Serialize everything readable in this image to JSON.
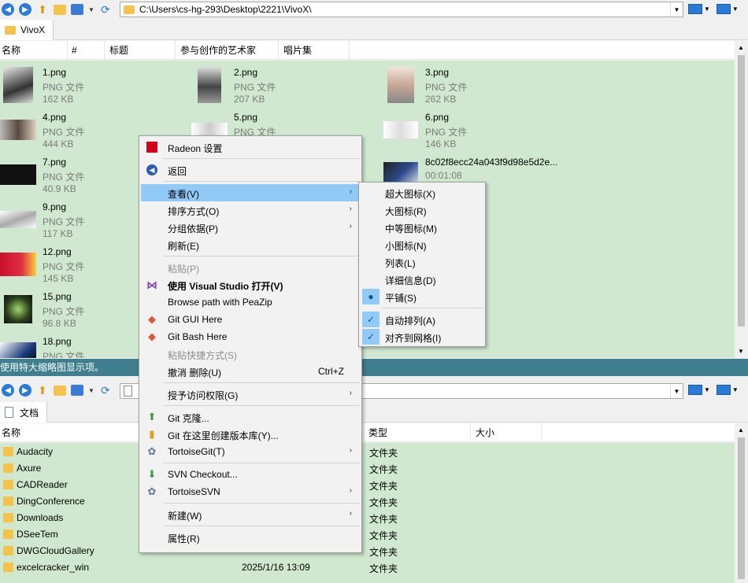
{
  "top_pane": {
    "address": "C:\\Users\\cs-hg-293\\Desktop\\2221\\VivoX\\",
    "tab_label": "VivoX",
    "columns": [
      "名称",
      "#",
      "标题",
      "参与创作的艺术家",
      "唱片集"
    ],
    "files": [
      {
        "name": "1.png",
        "type": "PNG 文件",
        "size": "162 KB"
      },
      {
        "name": "2.png",
        "type": "PNG 文件",
        "size": "207 KB"
      },
      {
        "name": "3.png",
        "type": "PNG 文件",
        "size": "262 KB"
      },
      {
        "name": "4.png",
        "type": "PNG 文件",
        "size": "444 KB"
      },
      {
        "name": "5.png",
        "type": "PNG 文件",
        "size": ""
      },
      {
        "name": "6.png",
        "type": "PNG 文件",
        "size": "146 KB"
      },
      {
        "name": "7.png",
        "type": "PNG 文件",
        "size": "40.9 KB"
      },
      {
        "name": "8c02f8ecc24a043f9d98e5d2e...",
        "type": "00:01:08",
        "size": ""
      },
      {
        "name": "9.png",
        "type": "PNG 文件",
        "size": "117 KB"
      },
      {
        "name": "12.png",
        "type": "PNG 文件",
        "size": "145 KB"
      },
      {
        "name": "15.png",
        "type": "PNG 文件",
        "size": "96.8 KB"
      },
      {
        "name": "18.png",
        "type": "PNG 文件",
        "size": ""
      }
    ],
    "status": "使用特大缩略图显示项。"
  },
  "bottom_pane": {
    "tab_label": "文档",
    "columns": [
      "名称",
      "类型",
      "大小"
    ],
    "rows": [
      {
        "name": "Audacity",
        "date": "",
        "type": "文件夹"
      },
      {
        "name": "Axure",
        "date": "",
        "type": "文件夹"
      },
      {
        "name": "CADReader",
        "date": "",
        "type": "文件夹"
      },
      {
        "name": "DingConference",
        "date": "",
        "type": "文件夹"
      },
      {
        "name": "Downloads",
        "date": "",
        "type": "文件夹"
      },
      {
        "name": "DSeeTem",
        "date": "",
        "type": "文件夹"
      },
      {
        "name": "DWGCloudGallery",
        "date": "",
        "type": "文件夹"
      },
      {
        "name": "excelcracker_win",
        "date": "2025/1/16 13:09",
        "type": "文件夹"
      }
    ]
  },
  "context_menu": {
    "radeon": "Radeon 设置",
    "back": "返回",
    "view": "查看(V)",
    "sort": "排序方式(O)",
    "group": "分组依据(P)",
    "refresh": "刷新(E)",
    "paste": "粘贴(P)",
    "open_vs": "使用 Visual Studio 打开(V)",
    "peazip": "Browse path with PeaZip",
    "git_gui": "Git GUI Here",
    "git_bash": "Git Bash Here",
    "paste_shortcut": "粘贴快捷方式(S)",
    "undo": "撤消 删除(U)",
    "undo_key": "Ctrl+Z",
    "access": "授予访问权限(G)",
    "git_clone": "Git 克隆...",
    "git_init": "Git 在这里创建版本库(Y)...",
    "tortoisegit": "TortoiseGit(T)",
    "svn_checkout": "SVN Checkout...",
    "tortoisesvn": "TortoiseSVN",
    "new": "新建(W)",
    "properties": "属性(R)"
  },
  "view_submenu": {
    "xl_icons": "超大图标(X)",
    "large_icons": "大图标(R)",
    "medium_icons": "中等图标(M)",
    "small_icons": "小图标(N)",
    "list": "列表(L)",
    "details": "详细信息(D)",
    "tiles": "平铺(S)",
    "auto_arrange": "自动排列(A)",
    "align_grid": "对齐到网格(I)"
  },
  "colors": {
    "pane_bg": "#cfe8cf",
    "highlight": "#91c9f7",
    "status_bar": "#3f7f8f"
  }
}
